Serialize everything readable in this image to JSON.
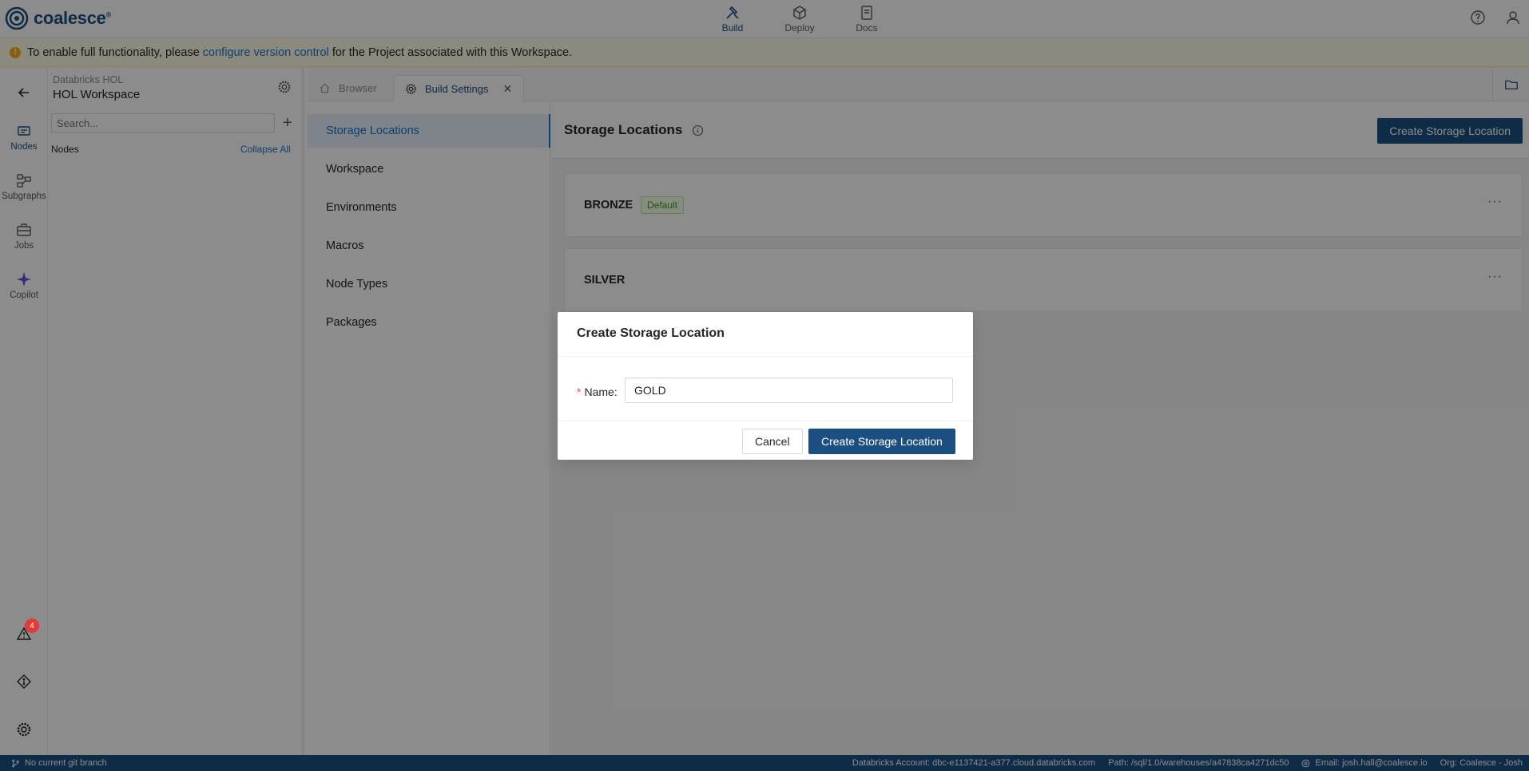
{
  "brand": {
    "name": "coalesce",
    "mark": "®"
  },
  "topnav": [
    {
      "label": "Build",
      "icon": "build-icon",
      "active": true
    },
    {
      "label": "Deploy",
      "icon": "deploy-icon",
      "active": false
    },
    {
      "label": "Docs",
      "icon": "docs-icon",
      "active": false
    }
  ],
  "banner": {
    "prefix": "To enable full functionality, please ",
    "link": "configure version control",
    "suffix": " for the Project associated with this Workspace."
  },
  "rail": [
    {
      "label": "Nodes",
      "active": true
    },
    {
      "label": "Subgraphs",
      "active": false
    },
    {
      "label": "Jobs",
      "active": false
    },
    {
      "label": "Copilot",
      "active": false
    }
  ],
  "alerts_count": "4",
  "explorer": {
    "project": "Databricks HOL",
    "workspace": "HOL Workspace",
    "search_placeholder": "Search...",
    "nodes_label": "Nodes",
    "collapse_all": "Collapse All"
  },
  "tabs": [
    {
      "label": "Browser",
      "active": false
    },
    {
      "label": "Build Settings",
      "active": true
    }
  ],
  "settings_nav": [
    "Storage Locations",
    "Workspace",
    "Environments",
    "Macros",
    "Node Types",
    "Packages"
  ],
  "content": {
    "title": "Storage Locations",
    "create_button": "Create Storage Location",
    "locations": [
      {
        "name": "BRONZE",
        "tag": "Default"
      },
      {
        "name": "SILVER",
        "tag": ""
      }
    ]
  },
  "modal": {
    "title": "Create Storage Location",
    "field_label": "Name",
    "field_value": "GOLD",
    "cancel": "Cancel",
    "submit": "Create Storage Location"
  },
  "statusbar": {
    "branch": "No current git branch",
    "account": "Databricks Account: dbc-e1137421-a377.cloud.databricks.com",
    "path": "Path: /sql/1.0/warehouses/a47838ca4271dc50",
    "email": "Email: josh.hall@coalesce.io",
    "org": "Org: Coalesce - Josh"
  },
  "colors": {
    "primary": "#1b4f82",
    "link": "#1677c9",
    "banner_bg": "#fffbe6",
    "default_tag": "#389e0d"
  }
}
